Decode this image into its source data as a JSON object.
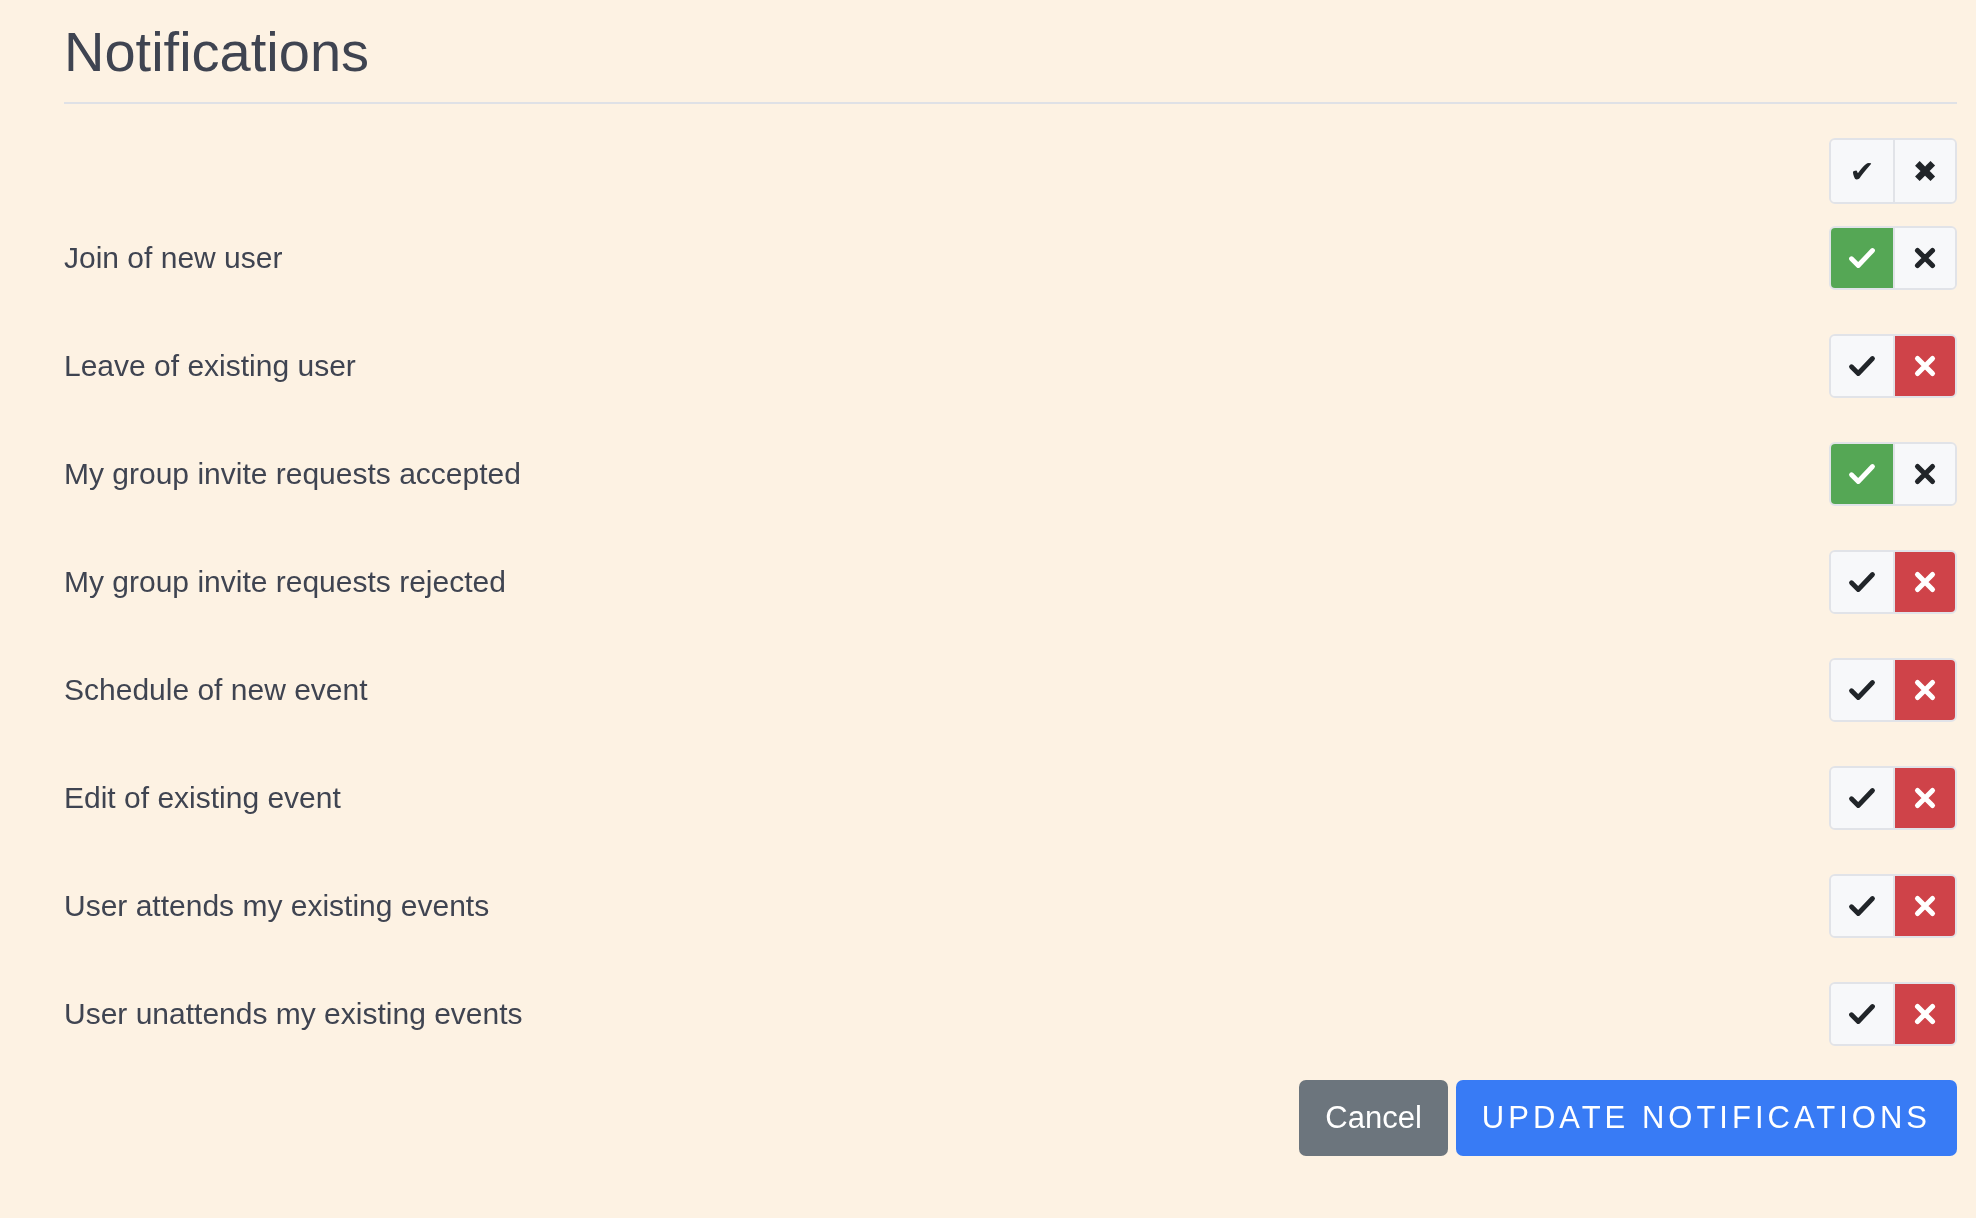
{
  "title": "Notifications",
  "bulk_toggle": {
    "all_on_label": "✔",
    "all_off_label": "✖"
  },
  "settings": [
    {
      "label": "Join of new user",
      "enabled": true
    },
    {
      "label": "Leave of existing user",
      "enabled": false
    },
    {
      "label": "My group invite requests accepted",
      "enabled": true
    },
    {
      "label": "My group invite requests rejected",
      "enabled": false
    },
    {
      "label": "Schedule of new event",
      "enabled": false
    },
    {
      "label": "Edit of existing event",
      "enabled": false
    },
    {
      "label": "User attends my existing events",
      "enabled": false
    },
    {
      "label": "User unattends my existing events",
      "enabled": false
    }
  ],
  "buttons": [
    {
      "label": "Cancel",
      "kind": "secondary"
    },
    {
      "label": "UPDATE NOTIFICATIONS",
      "kind": "primary"
    }
  ]
}
